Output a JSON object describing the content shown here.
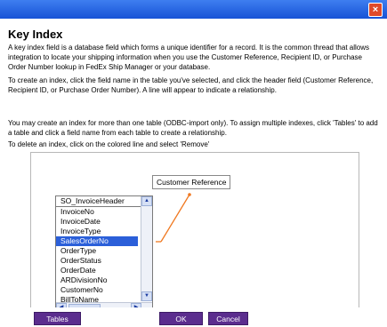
{
  "window": {
    "close_label": "×"
  },
  "main": {
    "heading": "Key Index",
    "paragraphs": [
      "A key index field is a database field which forms a unique identifier for a record. It is the common thread that allows integration to locate your shipping information when you use the Customer Reference, Recipient ID, or Purchase Order Number lookup in FedEx Ship Manager or your database.",
      "To create an index, click the field name in the table you've selected, and click the header field (Customer Reference, Recipient ID, or Purchase Order Number). A line will appear to indicate a relationship.",
      "You may create an index for more than one table (ODBC-import only). To assign multiple indexes, click 'Tables' to add a table and click a field name from each table to create a relationship.",
      "To delete an index, click on the colored line and select 'Remove'"
    ]
  },
  "diagram": {
    "header_field": "Customer Reference",
    "table_name": "SO_InvoiceHeader",
    "fields": [
      "InvoiceNo",
      "InvoiceDate",
      "InvoiceType",
      "SalesOrderNo",
      "OrderType",
      "OrderStatus",
      "OrderDate",
      "ARDivisionNo",
      "CustomerNo",
      "BillToName"
    ],
    "selected_field": "SalesOrderNo",
    "link_color": "#f07820"
  },
  "footer": {
    "tables_label": "Tables",
    "ok_label": "OK",
    "cancel_label": "Cancel"
  },
  "colors": {
    "titlebar": "#1a5ce0",
    "button": "#5b2d8e",
    "selection": "#2b5fd9"
  }
}
